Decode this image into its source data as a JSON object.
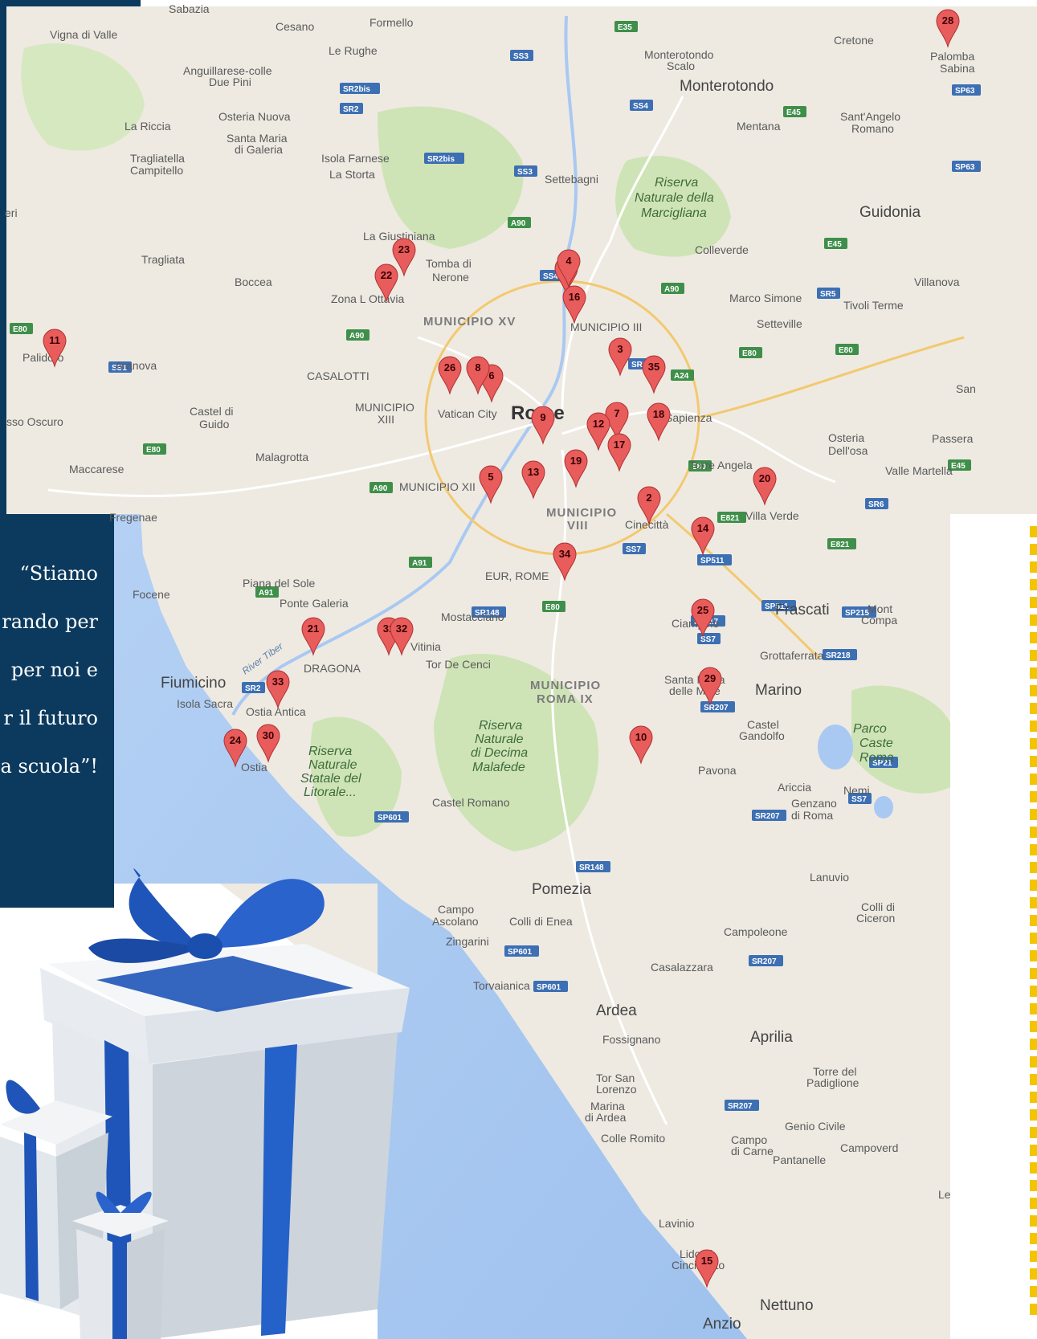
{
  "quote_lines": [
    "“Stiamo",
    "rando per",
    "per noi e",
    "r il futuro",
    "a scuola”!"
  ],
  "places": [
    {
      "id": "sabazia",
      "text": "Sabazia"
    },
    {
      "id": "vigna",
      "text": "Vigna di Valle"
    },
    {
      "id": "cesano",
      "text": "Cesano"
    },
    {
      "id": "formello",
      "text": "Formello"
    },
    {
      "id": "lerughe",
      "text": "Le Rughe"
    },
    {
      "id": "anguillara1",
      "text": "Anguillarese-colle"
    },
    {
      "id": "anguillara2",
      "text": "Due Pini"
    },
    {
      "id": "osteria",
      "text": "Osteria Nuova"
    },
    {
      "id": "lariccia",
      "text": "La Riccia"
    },
    {
      "id": "smaria1",
      "text": "Santa Maria"
    },
    {
      "id": "smaria2",
      "text": "di Galeria"
    },
    {
      "id": "tragliatella1",
      "text": "Tragliatella"
    },
    {
      "id": "tragliatella2",
      "text": "Campitello"
    },
    {
      "id": "isola",
      "text": "Isola Farnese"
    },
    {
      "id": "lastorta",
      "text": "La Storta"
    },
    {
      "id": "settebagni",
      "text": "Settebagni"
    },
    {
      "id": "monteroscalo1",
      "text": "Monterotondo"
    },
    {
      "id": "monteroscalo2",
      "text": "Scalo"
    },
    {
      "id": "monterotondo",
      "text": "Monterotondo"
    },
    {
      "id": "mentana",
      "text": "Mentana"
    },
    {
      "id": "cretone",
      "text": "Cretone"
    },
    {
      "id": "palomba1",
      "text": "Palomba"
    },
    {
      "id": "palomba2",
      "text": "Sabina"
    },
    {
      "id": "santangelo1",
      "text": "Sant'Angelo"
    },
    {
      "id": "santangelo2",
      "text": "Romano"
    },
    {
      "id": "riserva1",
      "text": "Riserva"
    },
    {
      "id": "riserva2",
      "text": "Naturale della"
    },
    {
      "id": "riserva3",
      "text": "Marcigliana"
    },
    {
      "id": "guidonia",
      "text": "Guidonia"
    },
    {
      "id": "colleverde",
      "text": "Colleverde"
    },
    {
      "id": "villanova",
      "text": "Villanova"
    },
    {
      "id": "marcosimone",
      "text": "Marco Simone"
    },
    {
      "id": "tivoli",
      "text": "Tivoli Terme"
    },
    {
      "id": "setteville",
      "text": "Setteville"
    },
    {
      "id": "laginstiniana",
      "text": "La Giustiniana"
    },
    {
      "id": "tragliata",
      "text": "Tragliata"
    },
    {
      "id": "boccea",
      "text": "Boccea"
    },
    {
      "id": "tomba1",
      "text": "Tomba di"
    },
    {
      "id": "tomba2",
      "text": "Nerone"
    },
    {
      "id": "ottavia",
      "text": "Zona L Ottavia"
    },
    {
      "id": "mun15",
      "text": "MUNICIPIO XV"
    },
    {
      "id": "mun3",
      "text": "MUNICIPIO III"
    },
    {
      "id": "palidoro",
      "text": "Palidoro"
    },
    {
      "id": "aranova",
      "text": "Aranova"
    },
    {
      "id": "casalotti",
      "text": "CASALOTTI"
    },
    {
      "id": "mun13a",
      "text": "MUNICIPIO"
    },
    {
      "id": "mun13b",
      "text": "XIII"
    },
    {
      "id": "vatican",
      "text": "Vatican City"
    },
    {
      "id": "rome",
      "text": "Rome"
    },
    {
      "id": "sapienza",
      "text": "Sapienza"
    },
    {
      "id": "castelguido1",
      "text": "Castel di"
    },
    {
      "id": "castelguido2",
      "text": "Guido"
    },
    {
      "id": "oscuro",
      "text": "sso Oscuro"
    },
    {
      "id": "malagrotta",
      "text": "Malagrotta"
    },
    {
      "id": "maccarese",
      "text": "Maccarese"
    },
    {
      "id": "osteriadellosa1",
      "text": "Osteria"
    },
    {
      "id": "osteriadellosa2",
      "text": "Dell'osa"
    },
    {
      "id": "passera",
      "text": "Passera"
    },
    {
      "id": "san",
      "text": "San"
    },
    {
      "id": "vallemartella",
      "text": "Valle Martella"
    },
    {
      "id": "torreangela",
      "text": "Torre Angela"
    },
    {
      "id": "villaverde",
      "text": "Villa Verde"
    },
    {
      "id": "mun12",
      "text": "MUNICIPIO XII"
    },
    {
      "id": "mun8a",
      "text": "MUNICIPIO"
    },
    {
      "id": "mun8b",
      "text": "VIII"
    },
    {
      "id": "cinecitta",
      "text": "Cinecittà"
    },
    {
      "id": "fregenae",
      "text": "Fregenae"
    },
    {
      "id": "focene",
      "text": "Focene"
    },
    {
      "id": "pianasole",
      "text": "Piana del Sole"
    },
    {
      "id": "pontegaleria",
      "text": "Ponte Galeria"
    },
    {
      "id": "eur",
      "text": "EUR, ROME"
    },
    {
      "id": "mostacciano",
      "text": "Mostacciano"
    },
    {
      "id": "vitinia",
      "text": "Vitinia"
    },
    {
      "id": "tordecenci",
      "text": "Tor De Cenci"
    },
    {
      "id": "dragona",
      "text": "DRAGONA"
    },
    {
      "id": "tiber",
      "text": "River Tiber"
    },
    {
      "id": "fiumicino",
      "text": "Fiumicino"
    },
    {
      "id": "isolasacra",
      "text": "Isola Sacra"
    },
    {
      "id": "ostiaantica",
      "text": "Ostia Antica"
    },
    {
      "id": "ostia",
      "text": "Ostia"
    },
    {
      "id": "ciampino",
      "text": "Ciampino"
    },
    {
      "id": "frascati",
      "text": "Frascati"
    },
    {
      "id": "montecomp1",
      "text": "Mont"
    },
    {
      "id": "montecomp2",
      "text": "Compa"
    },
    {
      "id": "grottaferrata",
      "text": "Grottaferrata"
    },
    {
      "id": "santamaria1",
      "text": "Santa Maria"
    },
    {
      "id": "santamaria2",
      "text": "delle Mole"
    },
    {
      "id": "marino",
      "text": "Marino"
    },
    {
      "id": "mun9a",
      "text": "MUNICIPIO"
    },
    {
      "id": "mun9b",
      "text": "ROMA IX"
    },
    {
      "id": "decima1",
      "text": "Riserva"
    },
    {
      "id": "decima2",
      "text": "Naturale"
    },
    {
      "id": "decima3",
      "text": "di Decima"
    },
    {
      "id": "decima4",
      "text": "Malafede"
    },
    {
      "id": "litorale1",
      "text": "Riserva"
    },
    {
      "id": "litorale2",
      "text": "Naturale"
    },
    {
      "id": "litorale3",
      "text": "Statale del"
    },
    {
      "id": "litorale4",
      "text": "Litorale..."
    },
    {
      "id": "castelgandolfo1",
      "text": "Castel"
    },
    {
      "id": "castelgandolfo2",
      "text": "Gandolfo"
    },
    {
      "id": "parco1",
      "text": "Parco"
    },
    {
      "id": "parco2",
      "text": "Caste"
    },
    {
      "id": "parco3",
      "text": "Roma"
    },
    {
      "id": "pavona",
      "text": "Pavona"
    },
    {
      "id": "ariccia",
      "text": "Ariccia"
    },
    {
      "id": "nemi",
      "text": "Nemi"
    },
    {
      "id": "genzano1",
      "text": "Genzano"
    },
    {
      "id": "genzano2",
      "text": "di Roma"
    },
    {
      "id": "castelromano",
      "text": "Castel Romano"
    },
    {
      "id": "lanuvio",
      "text": "Lanuvio"
    },
    {
      "id": "collidic1",
      "text": "Colli di"
    },
    {
      "id": "collidic2",
      "text": "Ciceron"
    },
    {
      "id": "pomezia",
      "text": "Pomezia"
    },
    {
      "id": "campo1",
      "text": "Campo"
    },
    {
      "id": "campo2",
      "text": "Ascolano"
    },
    {
      "id": "collienea",
      "text": "Colli di Enea"
    },
    {
      "id": "zingarini",
      "text": "Zingarini"
    },
    {
      "id": "campoleone",
      "text": "Campoleone"
    },
    {
      "id": "casalazzara",
      "text": "Casalazzara"
    },
    {
      "id": "torvaianica",
      "text": "Torvaianica"
    },
    {
      "id": "ardea",
      "text": "Ardea"
    },
    {
      "id": "fossignano",
      "text": "Fossignano"
    },
    {
      "id": "aprilia",
      "text": "Aprilia"
    },
    {
      "id": "torredel1",
      "text": "Torre del"
    },
    {
      "id": "torredel2",
      "text": "Padiglione"
    },
    {
      "id": "torsan1",
      "text": "Tor San"
    },
    {
      "id": "torsan2",
      "text": "Lorenzo"
    },
    {
      "id": "marina1",
      "text": "Marina"
    },
    {
      "id": "marina2",
      "text": "di Ardea"
    },
    {
      "id": "colleromito",
      "text": "Colle Romito"
    },
    {
      "id": "geniocivile",
      "text": "Genio Civile"
    },
    {
      "id": "campodi1",
      "text": "Campo"
    },
    {
      "id": "campodi2",
      "text": "di Carne"
    },
    {
      "id": "pantanelle",
      "text": "Pantanelle"
    },
    {
      "id": "campoverde",
      "text": "Campoverd"
    },
    {
      "id": "le",
      "text": "Le"
    },
    {
      "id": "lavinio",
      "text": "Lavinio"
    },
    {
      "id": "lido1",
      "text": "Lido di"
    },
    {
      "id": "lido2",
      "text": "Cincinnato"
    },
    {
      "id": "nettuno",
      "text": "Nettuno"
    },
    {
      "id": "anzio",
      "text": "Anzio"
    },
    {
      "id": "eri",
      "text": "eri"
    }
  ],
  "shields": [
    "E35",
    "SS3",
    "SR2bis",
    "SR2",
    "SR2bis",
    "SS3",
    "SS4",
    "E45",
    "SP63",
    "SP63",
    "A90",
    "E45",
    "SS4",
    "A90",
    "SR5",
    "E80",
    "A90",
    "SR5",
    "A24",
    "E80",
    "E80",
    "SS1",
    "E80",
    "A90",
    "E80",
    "SR6",
    "E821",
    "E45",
    "A91",
    "A91",
    "SS7",
    "SR148",
    "E80",
    "E821",
    "SP511",
    "SP511",
    "SP215",
    "SP217",
    "SS7",
    "SR218",
    "SR207",
    "SP21",
    "SS7",
    "SR207",
    "SP601",
    "SR148",
    "SP601",
    "SP601",
    "SR207",
    "SR207",
    "SR2"
  ],
  "markers": [
    {
      "label": "1"
    },
    {
      "label": "2"
    },
    {
      "label": "3"
    },
    {
      "label": "4"
    },
    {
      "label": "5"
    },
    {
      "label": "6"
    },
    {
      "label": "7"
    },
    {
      "label": "8"
    },
    {
      "label": "9"
    },
    {
      "label": "10"
    },
    {
      "label": "11"
    },
    {
      "label": "12"
    },
    {
      "label": "13"
    },
    {
      "label": "14"
    },
    {
      "label": "15"
    },
    {
      "label": "16"
    },
    {
      "label": "17"
    },
    {
      "label": "18"
    },
    {
      "label": "19"
    },
    {
      "label": "20"
    },
    {
      "label": "21"
    },
    {
      "label": "22"
    },
    {
      "label": "23"
    },
    {
      "label": "24"
    },
    {
      "label": "25"
    },
    {
      "label": "26"
    },
    {
      "label": "28"
    },
    {
      "label": "29"
    },
    {
      "label": "30"
    },
    {
      "label": "31"
    },
    {
      "label": "32"
    },
    {
      "label": "33"
    },
    {
      "label": "34"
    },
    {
      "label": "35"
    }
  ],
  "colors": {
    "navy": "#0b3a5e",
    "marker": "#e85c5c",
    "sea": "#a9c9f2",
    "land": "#efeae1",
    "park": "#cde3b3",
    "ribbon": "#1f55b8",
    "yellow": "#f2c500"
  }
}
